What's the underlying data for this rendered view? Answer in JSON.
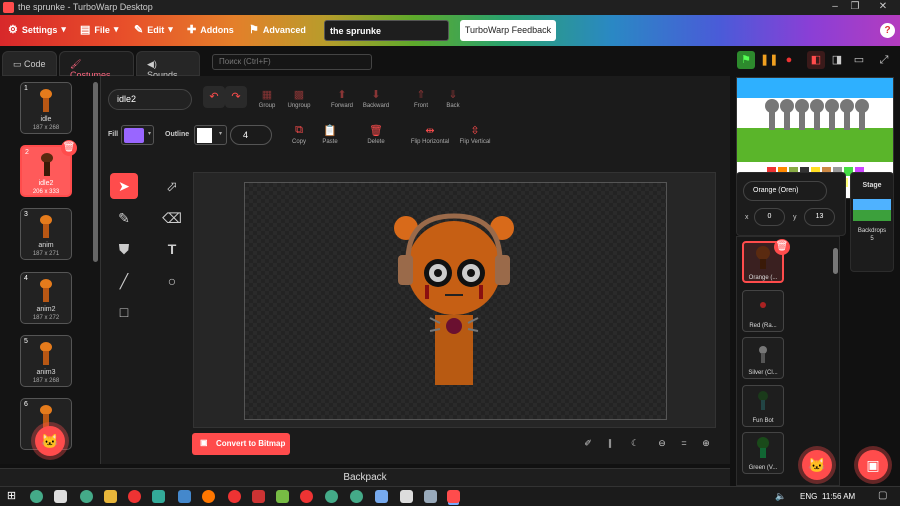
{
  "window": {
    "title": "the sprunke - TurboWarp Desktop"
  },
  "menu": {
    "settings": "Settings",
    "file": "File",
    "edit": "Edit",
    "addons": "Addons",
    "advanced": "Advanced",
    "project_title": "the sprunke",
    "feedback": "TurboWarp Feedback",
    "help": "?"
  },
  "tabs": {
    "code": "Code",
    "costumes": "Costumes",
    "sounds": "Sounds",
    "search_placeholder": "Поиск (Ctrl+F)"
  },
  "costumes": [
    {
      "num": "1",
      "name": "idle",
      "dims": "187 x 268"
    },
    {
      "num": "2",
      "name": "idle2",
      "dims": "206 x 333",
      "selected": true
    },
    {
      "num": "3",
      "name": "anim",
      "dims": "187 x 271"
    },
    {
      "num": "4",
      "name": "anim2",
      "dims": "187 x 272"
    },
    {
      "num": "5",
      "name": "anim3",
      "dims": "187 x 268"
    },
    {
      "num": "6",
      "name": "",
      "dims": ""
    }
  ],
  "paint": {
    "costume_name": "idle2",
    "group": "Group",
    "ungroup": "Ungroup",
    "forward": "Forward",
    "backward": "Backward",
    "front": "Front",
    "back": "Back",
    "fill_label": "Fill",
    "outline_label": "Outline",
    "outline_width": "4",
    "copy": "Copy",
    "paste": "Paste",
    "delete": "Delete",
    "flip_h": "Flip Horizontal",
    "flip_v": "Flip Vertical",
    "convert": "Convert to Bitmap",
    "fill_color": "#9966ff",
    "accent": "#ff4c4c"
  },
  "backpack": "Backpack",
  "stage": {
    "label": "Stage",
    "backdrops_label": "Backdrops",
    "backdrops_count": "5"
  },
  "sprite": {
    "name": "Orange (Oren)",
    "x_label": "x",
    "x": "0",
    "y_label": "y",
    "y": "13"
  },
  "sprites": [
    {
      "name": "Orange (...",
      "selected": true
    },
    {
      "name": "Red (Ra..."
    },
    {
      "name": "Silver (Cl..."
    },
    {
      "name": "Fun Bot"
    },
    {
      "name": "Green (V..."
    }
  ],
  "taskbar": {
    "lang": "ENG",
    "time": "11:56 AM"
  }
}
